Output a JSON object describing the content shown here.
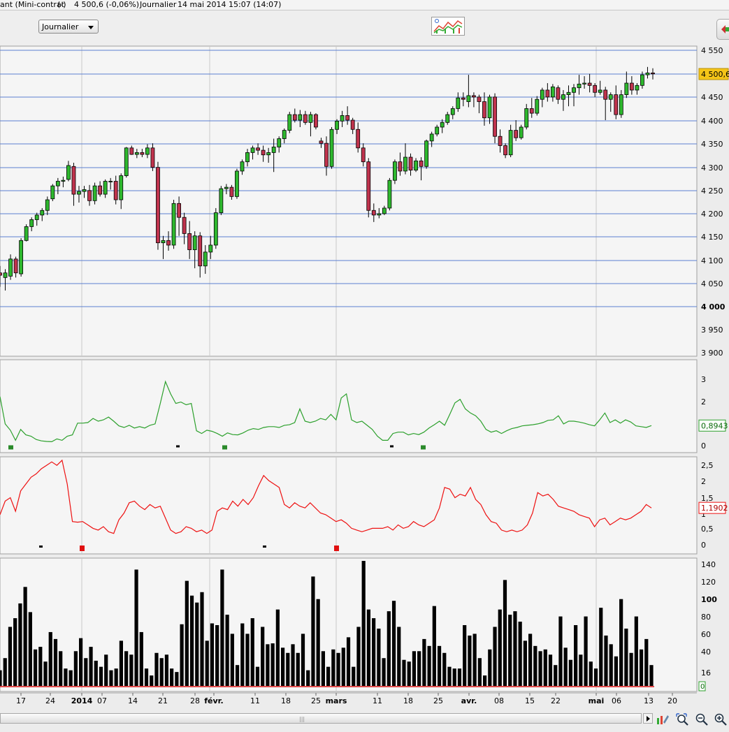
{
  "title": {
    "instrument": "ant (Mini-contrat",
    "currency": "(-)",
    "price_change": "4 500,6 (-0,06%)",
    "period": "Journalier",
    "datetime": "14 mai 2014 15:07 (14:07)"
  },
  "toolbar": {
    "period_selected": "Journalier"
  },
  "colors": {
    "up_candle": "#2eb82e",
    "down_candle": "#c0334d",
    "gridline": "#5b7fd1",
    "indicator1_line": "#2ca02c",
    "indicator2_line": "#ee1111",
    "volume_bar": "#000000",
    "price_badge": "#f5c518"
  },
  "chart_data": [
    {
      "type": "candlestick",
      "name": "price",
      "y_ticks": [
        "4 550",
        "4 450",
        "4 400",
        "4 350",
        "4 300",
        "4 250",
        "4 200",
        "4 150",
        "4 100",
        "4 050",
        "4 000",
        "3 950",
        "3 900"
      ],
      "ylim": [
        3890,
        4560
      ],
      "last_value": "4 500,6",
      "grid": true,
      "ohlc": [
        [
          4070,
          4085,
          4040,
          4065
        ],
        [
          4060,
          4078,
          4032,
          4070
        ],
        [
          4063,
          4110,
          4055,
          4100
        ],
        [
          4100,
          4105,
          4060,
          4070
        ],
        [
          4068,
          4145,
          4062,
          4140
        ],
        [
          4140,
          4175,
          4138,
          4170
        ],
        [
          4170,
          4190,
          4160,
          4185
        ],
        [
          4185,
          4200,
          4172,
          4195
        ],
        [
          4195,
          4210,
          4182,
          4205
        ],
        [
          4205,
          4235,
          4195,
          4228
        ],
        [
          4230,
          4262,
          4225,
          4258
        ],
        [
          4258,
          4275,
          4240,
          4268
        ],
        [
          4268,
          4278,
          4255,
          4270
        ],
        [
          4272,
          4312,
          4268,
          4302
        ],
        [
          4300,
          4308,
          4215,
          4240
        ],
        [
          4240,
          4258,
          4222,
          4246
        ],
        [
          4246,
          4258,
          4232,
          4250
        ],
        [
          4248,
          4260,
          4215,
          4226
        ],
        [
          4226,
          4265,
          4218,
          4258
        ],
        [
          4258,
          4268,
          4235,
          4240
        ],
        [
          4240,
          4272,
          4232,
          4268
        ],
        [
          4268,
          4275,
          4250,
          4268
        ],
        [
          4268,
          4280,
          4218,
          4228
        ],
        [
          4228,
          4285,
          4208,
          4280
        ],
        [
          4280,
          4342,
          4276,
          4340
        ],
        [
          4340,
          4345,
          4325,
          4326
        ],
        [
          4326,
          4338,
          4318,
          4330
        ],
        [
          4330,
          4338,
          4320,
          4326
        ],
        [
          4326,
          4348,
          4318,
          4340
        ],
        [
          4340,
          4350,
          4290,
          4298
        ],
        [
          4298,
          4310,
          4120,
          4135
        ],
        [
          4135,
          4150,
          4100,
          4140
        ],
        [
          4140,
          4160,
          4118,
          4130
        ],
        [
          4130,
          4228,
          4122,
          4220
        ],
        [
          4220,
          4235,
          4150,
          4190
        ],
        [
          4190,
          4200,
          4132,
          4155
        ],
        [
          4155,
          4182,
          4100,
          4120
        ],
        [
          4120,
          4160,
          4080,
          4150
        ],
        [
          4150,
          4158,
          4060,
          4085
        ],
        [
          4085,
          4130,
          4068,
          4115
        ],
        [
          4115,
          4150,
          4100,
          4130
        ],
        [
          4130,
          4210,
          4122,
          4200
        ],
        [
          4200,
          4258,
          4195,
          4252
        ],
        [
          4252,
          4262,
          4240,
          4255
        ],
        [
          4255,
          4260,
          4228,
          4235
        ],
        [
          4235,
          4295,
          4230,
          4290
        ],
        [
          4290,
          4315,
          4282,
          4310
        ],
        [
          4310,
          4338,
          4300,
          4330
        ],
        [
          4330,
          4345,
          4315,
          4340
        ],
        [
          4340,
          4350,
          4325,
          4335
        ],
        [
          4335,
          4345,
          4310,
          4325
        ],
        [
          4325,
          4340,
          4308,
          4330
        ],
        [
          4330,
          4360,
          4288,
          4342
        ],
        [
          4342,
          4365,
          4330,
          4360
        ],
        [
          4360,
          4382,
          4350,
          4378
        ],
        [
          4378,
          4418,
          4372,
          4412
        ],
        [
          4412,
          4425,
          4395,
          4400
        ],
        [
          4400,
          4422,
          4385,
          4412
        ],
        [
          4412,
          4420,
          4390,
          4395
        ],
        [
          4395,
          4418,
          4365,
          4412
        ],
        [
          4412,
          4415,
          4380,
          4385
        ],
        [
          4355,
          4362,
          4340,
          4350
        ],
        [
          4350,
          4365,
          4280,
          4300
        ],
        [
          4300,
          4385,
          4295,
          4380
        ],
        [
          4380,
          4402,
          4370,
          4398
        ],
        [
          4398,
          4420,
          4385,
          4410
        ],
        [
          4410,
          4430,
          4390,
          4400
        ],
        [
          4400,
          4405,
          4370,
          4380
        ],
        [
          4380,
          4395,
          4330,
          4340
        ],
        [
          4340,
          4350,
          4300,
          4310
        ],
        [
          4310,
          4318,
          4190,
          4205
        ],
        [
          4205,
          4220,
          4180,
          4195
        ],
        [
          4195,
          4210,
          4188,
          4198
        ],
        [
          4198,
          4215,
          4195,
          4210
        ],
        [
          4210,
          4275,
          4205,
          4270
        ],
        [
          4270,
          4315,
          4262,
          4310
        ],
        [
          4310,
          4330,
          4280,
          4290
        ],
        [
          4290,
          4350,
          4283,
          4320
        ],
        [
          4320,
          4328,
          4280,
          4292
        ],
        [
          4292,
          4318,
          4288,
          4312
        ],
        [
          4312,
          4320,
          4270,
          4300
        ],
        [
          4300,
          4358,
          4295,
          4355
        ],
        [
          4355,
          4375,
          4342,
          4370
        ],
        [
          4370,
          4390,
          4365,
          4385
        ],
        [
          4385,
          4402,
          4372,
          4395
        ],
        [
          4395,
          4418,
          4390,
          4412
        ],
        [
          4412,
          4430,
          4402,
          4425
        ],
        [
          4425,
          4460,
          4418,
          4448
        ],
        [
          4448,
          4460,
          4430,
          4445
        ],
        [
          4440,
          4498,
          4428,
          4453
        ],
        [
          4453,
          4460,
          4428,
          4450
        ],
        [
          4450,
          4455,
          4415,
          4440
        ],
        [
          4440,
          4460,
          4388,
          4405
        ],
        [
          4405,
          4455,
          4392,
          4450
        ],
        [
          4450,
          4458,
          4350,
          4365
        ],
        [
          4365,
          4380,
          4330,
          4345
        ],
        [
          4345,
          4350,
          4318,
          4325
        ],
        [
          4325,
          4390,
          4320,
          4378
        ],
        [
          4378,
          4400,
          4355,
          4362
        ],
        [
          4362,
          4390,
          4358,
          4385
        ],
        [
          4385,
          4435,
          4380,
          4425
        ],
        [
          4425,
          4448,
          4405,
          4415
        ],
        [
          4415,
          4452,
          4410,
          4445
        ],
        [
          4445,
          4470,
          4428,
          4465
        ],
        [
          4465,
          4480,
          4440,
          4450
        ],
        [
          4450,
          4478,
          4440,
          4472
        ],
        [
          4470,
          4475,
          4435,
          4445
        ],
        [
          4445,
          4465,
          4420,
          4455
        ],
        [
          4455,
          4475,
          4430,
          4460
        ],
        [
          4460,
          4478,
          4430,
          4470
        ],
        [
          4470,
          4498,
          4455,
          4478
        ],
        [
          4478,
          4495,
          4468,
          4480
        ],
        [
          4480,
          4500,
          4460,
          4475
        ],
        [
          4475,
          4480,
          4450,
          4460
        ],
        [
          4460,
          4485,
          4455,
          4465
        ],
        [
          4465,
          4472,
          4400,
          4445
        ],
        [
          4445,
          4460,
          4418,
          4455
        ],
        [
          4455,
          4475,
          4402,
          4412
        ],
        [
          4412,
          4465,
          4405,
          4455
        ],
        [
          4455,
          4505,
          4448,
          4480
        ],
        [
          4480,
          4495,
          4455,
          4465
        ],
        [
          4465,
          4480,
          4455,
          4475
        ],
        [
          4475,
          4505,
          4468,
          4498
        ],
        [
          4498,
          4515,
          4490,
          4502
        ],
        [
          4502,
          4512,
          4488,
          4500
        ]
      ]
    },
    {
      "type": "line",
      "name": "indicator_1",
      "y_ticks": [
        "3",
        "2",
        "0"
      ],
      "ylim": [
        -0.1,
        3.3
      ],
      "last_value": "0,8943",
      "values": [
        1.95,
        0.95,
        0.72,
        0.35,
        0.75,
        0.55,
        0.5,
        0.38,
        0.33,
        0.31,
        0.3,
        0.4,
        0.35,
        0.5,
        0.55,
        0.98,
        0.98,
        1.0,
        1.15,
        1.05,
        1.1,
        1.2,
        1.05,
        0.88,
        0.82,
        0.9,
        0.8,
        0.85,
        0.8,
        0.9,
        0.95,
        1.7,
        2.5,
        2.05,
        1.7,
        1.75,
        1.65,
        1.7,
        0.7,
        0.6,
        0.72,
        0.68,
        0.6,
        0.5,
        0.62,
        0.56,
        0.55,
        0.62,
        0.72,
        0.78,
        0.75,
        0.82,
        0.85,
        0.85,
        0.82,
        0.9,
        0.92,
        1.0,
        1.5,
        1.05,
        1.0,
        1.05,
        1.15,
        1.1,
        1.3,
        1.1,
        1.9,
        2.05,
        1.1,
        1.0,
        1.05,
        0.9,
        0.75,
        0.5,
        0.35,
        0.35,
        0.6,
        0.65,
        0.65,
        0.55,
        0.6,
        0.56,
        0.65,
        0.8,
        0.92,
        1.05,
        0.9,
        1.3,
        1.72,
        1.85,
        1.5,
        1.35,
        1.25,
        1.05,
        0.75,
        0.65,
        0.7,
        0.6,
        0.7,
        0.78,
        0.82,
        0.88,
        0.9,
        0.92,
        0.95,
        1.0,
        1.08,
        1.1,
        1.25,
        0.95,
        1.05,
        1.05,
        1.02,
        0.98,
        0.92,
        0.88,
        1.1,
        1.35,
        1.0,
        1.1,
        0.98,
        1.1,
        1.02,
        0.88,
        0.85,
        0.82,
        0.89
      ]
    },
    {
      "type": "line",
      "name": "indicator_2",
      "y_ticks": [
        "2,5",
        "2",
        "1,5",
        "1",
        "0,5",
        "0"
      ],
      "ylim": [
        -0.15,
        2.7
      ],
      "last_value": "1,1902",
      "values": [
        1.0,
        1.4,
        1.5,
        1.1,
        1.7,
        1.9,
        2.1,
        2.2,
        2.35,
        2.45,
        2.55,
        2.45,
        2.6,
        1.9,
        0.8,
        0.78,
        0.8,
        0.7,
        0.6,
        0.55,
        0.65,
        0.5,
        0.45,
        0.85,
        1.05,
        1.35,
        1.4,
        1.25,
        1.15,
        1.3,
        1.2,
        1.25,
        0.9,
        0.55,
        0.45,
        0.5,
        0.65,
        0.6,
        0.5,
        0.55,
        0.45,
        0.55,
        1.1,
        1.2,
        1.15,
        1.4,
        1.25,
        1.45,
        1.3,
        1.5,
        1.85,
        2.15,
        2.0,
        1.9,
        1.8,
        1.3,
        1.2,
        1.35,
        1.25,
        1.2,
        1.35,
        1.2,
        1.05,
        1.0,
        0.9,
        0.8,
        0.85,
        0.75,
        0.6,
        0.55,
        0.5,
        0.55,
        0.6,
        0.6,
        0.6,
        0.65,
        0.55,
        0.7,
        0.6,
        0.65,
        0.8,
        0.7,
        0.65,
        0.75,
        0.85,
        1.2,
        1.8,
        1.75,
        1.5,
        1.6,
        1.55,
        1.8,
        1.45,
        1.3,
        1.0,
        0.8,
        0.75,
        0.55,
        0.5,
        0.55,
        0.5,
        0.55,
        0.7,
        1.05,
        1.65,
        1.55,
        1.6,
        1.45,
        1.25,
        1.2,
        1.15,
        1.1,
        1.0,
        0.95,
        0.9,
        0.65,
        0.85,
        0.9,
        0.7,
        0.8,
        0.9,
        0.85,
        0.9,
        1.0,
        1.1,
        1.3,
        1.2
      ]
    },
    {
      "type": "bar",
      "name": "volume",
      "y_ticks": [
        "140",
        "120",
        "100",
        "80",
        "60",
        "40",
        "16",
        "0"
      ],
      "ylim": [
        0,
        145
      ],
      "last_value": "0",
      "values": [
        18,
        32,
        68,
        78,
        95,
        114,
        85,
        42,
        45,
        28,
        62,
        54,
        40,
        20,
        18,
        40,
        55,
        32,
        45,
        29,
        22,
        36,
        18,
        20,
        52,
        40,
        36,
        134,
        62,
        20,
        12,
        38,
        32,
        36,
        20,
        16,
        71,
        121,
        104,
        96,
        108,
        52,
        72,
        70,
        134,
        82,
        60,
        24,
        72,
        60,
        78,
        22,
        68,
        48,
        49,
        88,
        44,
        38,
        48,
        38,
        60,
        18,
        126,
        100,
        40,
        22,
        42,
        38,
        44,
        56,
        22,
        68,
        144,
        88,
        78,
        66,
        32,
        86,
        98,
        68,
        30,
        28,
        40,
        40,
        54,
        46,
        92,
        46,
        38,
        22,
        20,
        20,
        70,
        58,
        60,
        32,
        12,
        42,
        68,
        88,
        122,
        82,
        86,
        74,
        52,
        60,
        46,
        40,
        42,
        36,
        24,
        80,
        44,
        30,
        70,
        36,
        80,
        28,
        20,
        90,
        58,
        48,
        34,
        100,
        66,
        38,
        80,
        42,
        54,
        24
      ]
    }
  ],
  "x_axis": {
    "labels": [
      "17",
      "24",
      "2014",
      "07",
      "14",
      "21",
      "28",
      "févr.",
      "11",
      "18",
      "25",
      "mars",
      "11",
      "18",
      "25",
      "avr.",
      "08",
      "15",
      "22",
      "mai",
      "06",
      "13",
      "20"
    ]
  }
}
